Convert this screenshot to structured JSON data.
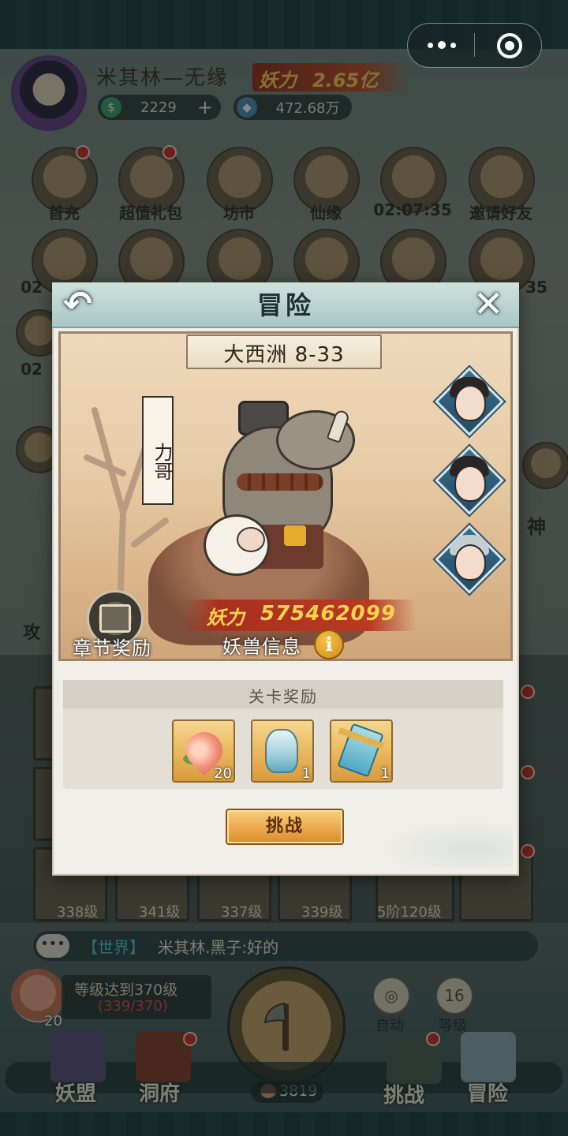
{
  "system": {
    "capsule": {
      "more_icon": "more-dots-icon",
      "close_icon": "mini-program-close-icon"
    }
  },
  "player": {
    "name": "米其林—无缘",
    "power_label": "妖力",
    "power_value": "2.65亿",
    "currency_jade": "2229",
    "currency_crystal": "472.68万"
  },
  "menu": {
    "row1": [
      "首充",
      "超值礼包",
      "坊市",
      "仙缘",
      "02:07:35",
      "邀请好友"
    ],
    "row2_partial": [
      "02",
      "35"
    ],
    "row3_partial": [
      "02"
    ],
    "side_right": "神",
    "side_left": "攻"
  },
  "cards": {
    "levels": [
      "338级",
      "341级",
      "337级",
      "339级",
      "5阶120级"
    ]
  },
  "chat": {
    "icon_text": "•••",
    "channel": "【世界】",
    "message": "米其林.黑子:好的"
  },
  "level_goal": {
    "count": "20",
    "text": "等级达到370级",
    "progress": "(339/370)"
  },
  "bottom": {
    "auto_label": "自动",
    "level_value": "16",
    "level_label": "等级",
    "axe_count": "3819",
    "nav": [
      "妖盟",
      "洞府",
      "挑战",
      "冒险"
    ]
  },
  "modal": {
    "title": "冒险",
    "back_symbol": "↶",
    "close_symbol": "✕",
    "stage": "大西洲 8-33",
    "boss_name": "力哥",
    "power_label": "妖力",
    "power_value": "575462099",
    "chapter_reward_label": "章节奖励",
    "monster_info_label": "妖兽信息",
    "info_symbol": "i",
    "rewards_title": "关卡奖励",
    "rewards": [
      {
        "icon": "peach-icon",
        "count": "20"
      },
      {
        "icon": "vase-icon",
        "count": "1"
      },
      {
        "icon": "scroll-icon",
        "count": "1"
      }
    ],
    "challenge_button": "挑战"
  }
}
